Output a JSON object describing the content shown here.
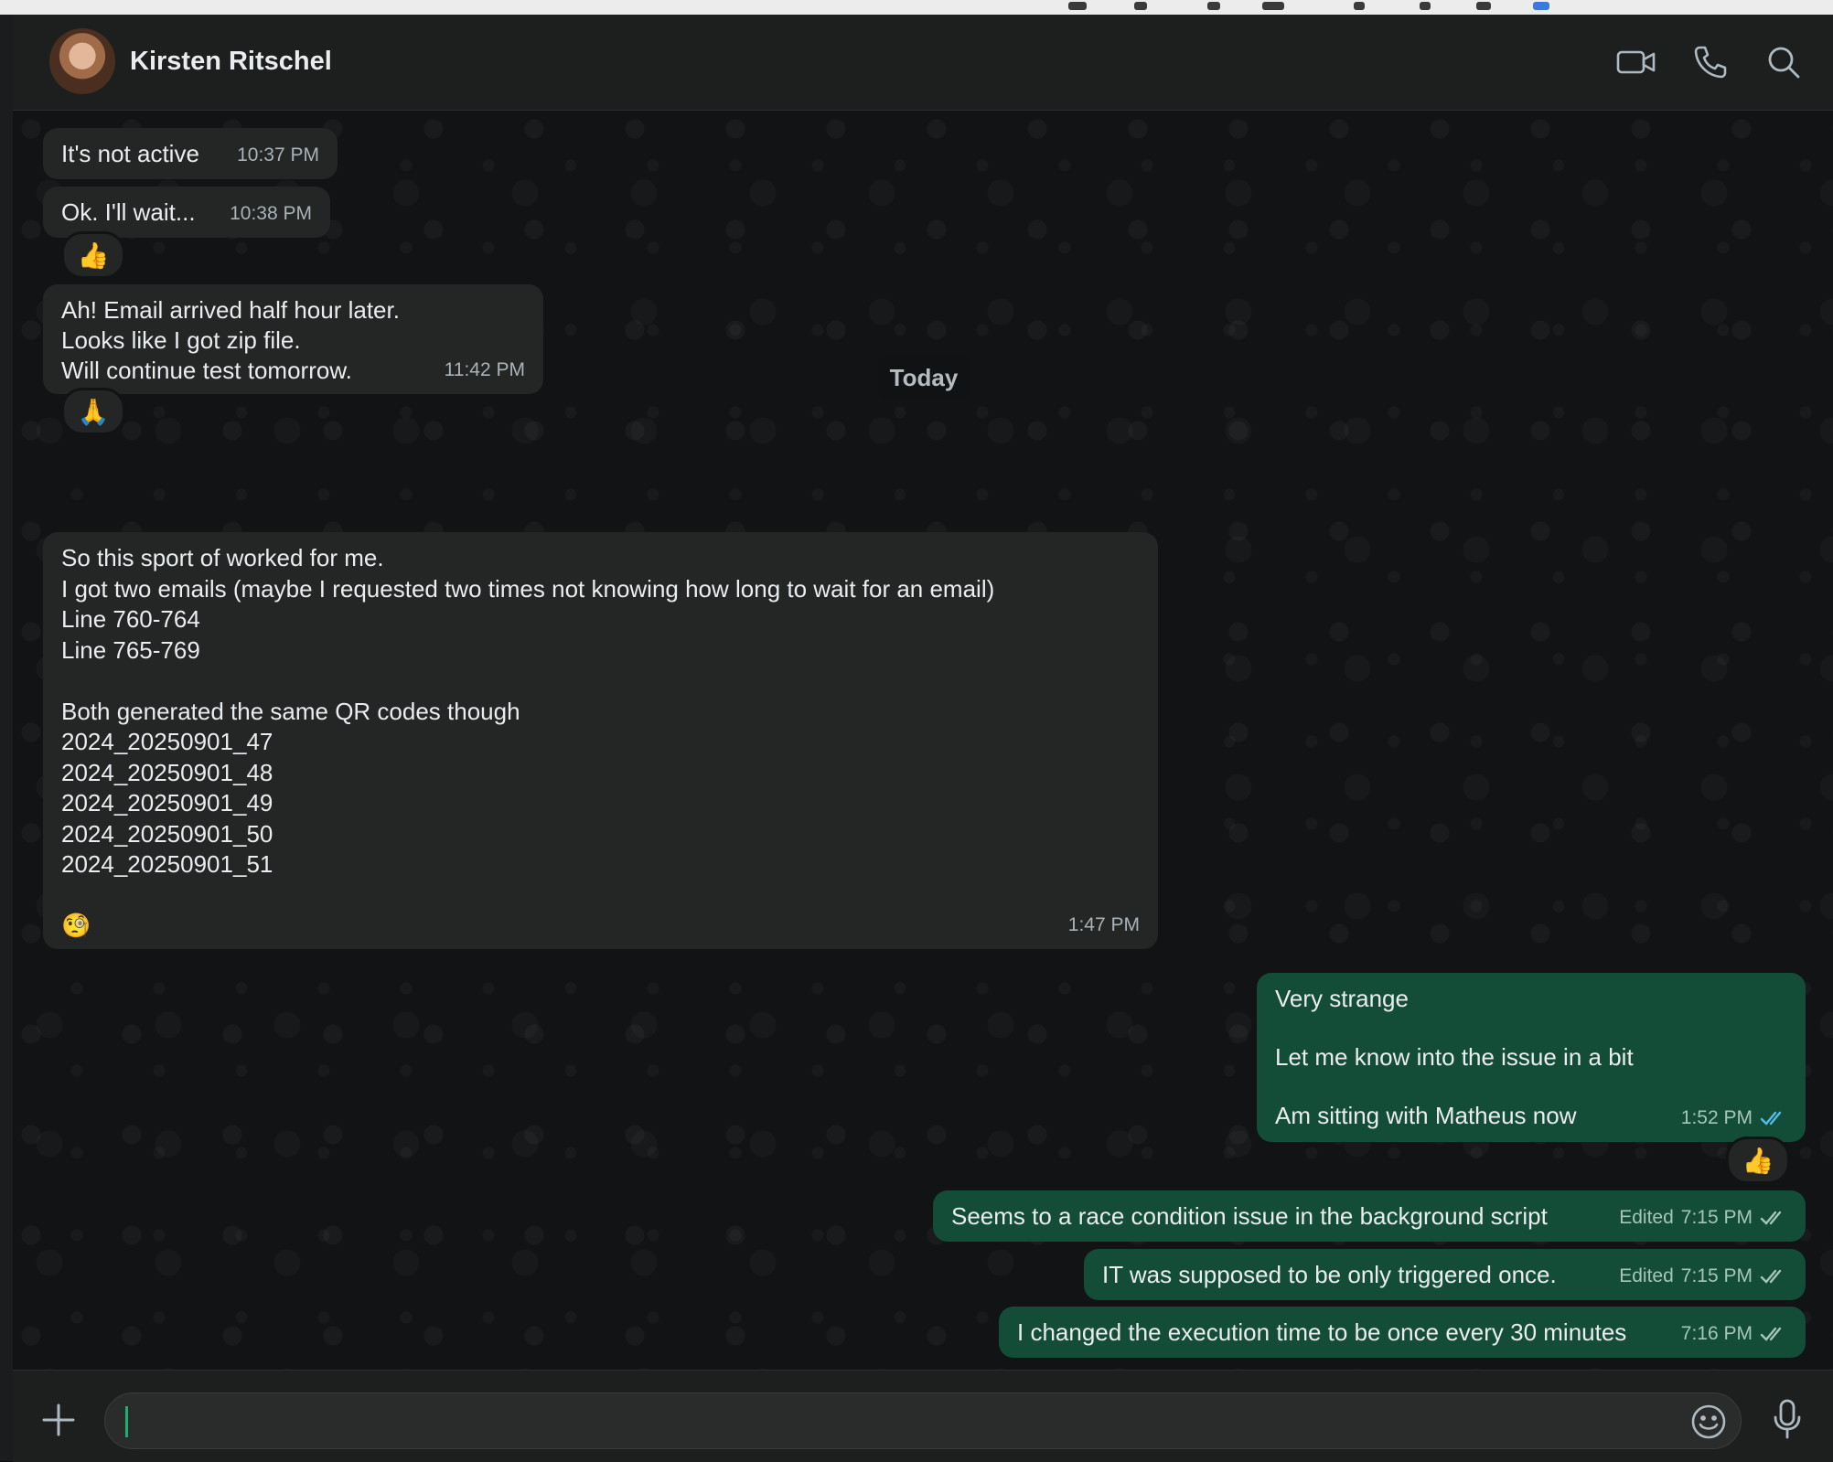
{
  "contact": {
    "name": "Kirsten Ritschel"
  },
  "header_icons": [
    "video-icon",
    "phone-icon",
    "search-icon"
  ],
  "messages": [
    {
      "text": "It's not active",
      "time": "10:37 PM"
    },
    {
      "text": "Ok. I'll wait...",
      "time": "10:38 PM",
      "reaction": "👍"
    },
    {
      "text": "Ah! Email arrived half hour later.\nLooks like I got zip file.\nWill continue test tomorrow.",
      "time": "11:42 PM",
      "reaction": "🙏"
    },
    {
      "day_divider": "Today"
    },
    {
      "text": "So this sport of worked for me.\nI got two emails (maybe I requested two times not knowing how long to wait for an email)\nLine 760-764\nLine 765-769\n\nBoth generated the same QR codes though\n2024_20250901_47\n2024_20250901_48\n2024_20250901_49\n2024_20250901_50\n2024_20250901_51\n\n🧐",
      "time": "1:47 PM"
    },
    {
      "text": "Very strange\n\nLet me know into the issue in a bit\n\nAm sitting with Matheus now",
      "time": "1:52 PM",
      "reaction": "👍"
    },
    {
      "text": "Seems to a race condition issue in the background script",
      "edited": "Edited",
      "time": "7:15 PM"
    },
    {
      "text": "IT was supposed to be only triggered once.",
      "edited": "Edited",
      "time": "7:15 PM"
    },
    {
      "text": "I changed the execution time to be once every 30 minutes",
      "time": "7:16 PM"
    }
  ],
  "composer": {
    "value": "",
    "placeholder": ""
  },
  "colors": {
    "incoming": "#242626",
    "outgoing": "#144d37",
    "read_ticks": "#53bdeb",
    "delivered_ticks": "#a4c6b8",
    "accent": "#1fad70"
  }
}
